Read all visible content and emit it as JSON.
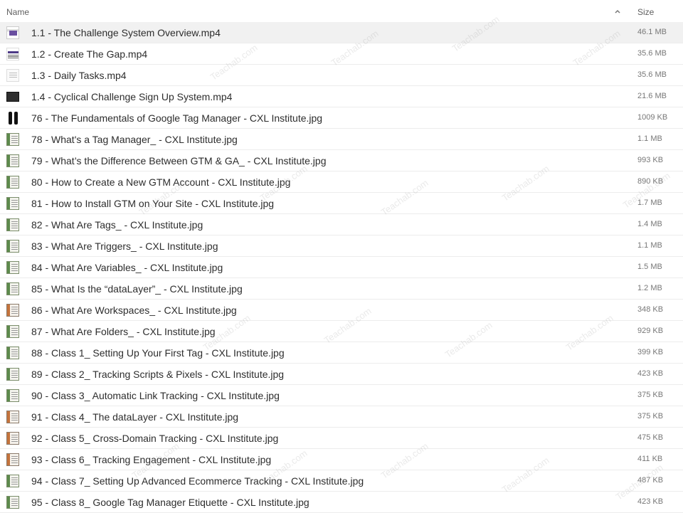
{
  "header": {
    "name_label": "Name",
    "size_label": "Size",
    "sort_icon": "chevron-up-icon"
  },
  "files": [
    {
      "name": "1.1 - The Challenge System Overview.mp4",
      "size": "46.1 MB",
      "thumb": "video-a"
    },
    {
      "name": "1.2 - Create The Gap.mp4",
      "size": "35.6 MB",
      "thumb": "video-b"
    },
    {
      "name": "1.3 - Daily Tasks.mp4",
      "size": "35.6 MB",
      "thumb": "video-c"
    },
    {
      "name": "1.4 - Cyclical Challenge Sign Up System.mp4",
      "size": "21.6 MB",
      "thumb": "video-d"
    },
    {
      "name": "76 - The Fundamentals of Google Tag Manager - CXL Institute.jpg",
      "size": "1009 KB",
      "thumb": "phone"
    },
    {
      "name": "78 - What's a Tag Manager_ - CXL Institute.jpg",
      "size": "1.1 MB",
      "thumb": "doc"
    },
    {
      "name": "79 - What’s the Difference Between GTM & GA_ - CXL Institute.jpg",
      "size": "993 KB",
      "thumb": "doc"
    },
    {
      "name": "80 - How to Create a New GTM Account - CXL Institute.jpg",
      "size": "890 KB",
      "thumb": "doc"
    },
    {
      "name": "81 - How to Install GTM on Your Site - CXL Institute.jpg",
      "size": "1.7 MB",
      "thumb": "doc"
    },
    {
      "name": "82 - What Are Tags_ - CXL Institute.jpg",
      "size": "1.4 MB",
      "thumb": "doc"
    },
    {
      "name": "83 - What Are Triggers_ - CXL Institute.jpg",
      "size": "1.1 MB",
      "thumb": "doc"
    },
    {
      "name": "84 - What Are Variables_ - CXL Institute.jpg",
      "size": "1.5 MB",
      "thumb": "doc"
    },
    {
      "name": "85 - What Is the “dataLayer”_ - CXL Institute.jpg",
      "size": "1.2 MB",
      "thumb": "doc"
    },
    {
      "name": "86 - What Are Workspaces_ - CXL Institute.jpg",
      "size": "348 KB",
      "thumb": "doc-o"
    },
    {
      "name": "87 - What Are Folders_ - CXL Institute.jpg",
      "size": "929 KB",
      "thumb": "doc"
    },
    {
      "name": "88 - Class 1_ Setting Up Your First Tag - CXL Institute.jpg",
      "size": "399 KB",
      "thumb": "doc"
    },
    {
      "name": "89 - Class 2_ Tracking Scripts & Pixels - CXL Institute.jpg",
      "size": "423 KB",
      "thumb": "doc"
    },
    {
      "name": "90 - Class 3_ Automatic Link Tracking - CXL Institute.jpg",
      "size": "375 KB",
      "thumb": "doc"
    },
    {
      "name": "91 - Class 4_ The dataLayer - CXL Institute.jpg",
      "size": "375 KB",
      "thumb": "doc-o"
    },
    {
      "name": "92 - Class 5_ Cross-Domain Tracking - CXL Institute.jpg",
      "size": "475 KB",
      "thumb": "doc-o"
    },
    {
      "name": "93 - Class 6_ Tracking Engagement - CXL Institute.jpg",
      "size": "411 KB",
      "thumb": "doc-o"
    },
    {
      "name": "94 - Class 7_ Setting Up Advanced Ecommerce Tracking - CXL Institute.jpg",
      "size": "487 KB",
      "thumb": "doc"
    },
    {
      "name": "95 - Class 8_ Google Tag Manager Etiquette - CXL Institute.jpg",
      "size": "423 KB",
      "thumb": "doc"
    }
  ],
  "selected_index": 0,
  "watermark_text": "Teachab.com"
}
